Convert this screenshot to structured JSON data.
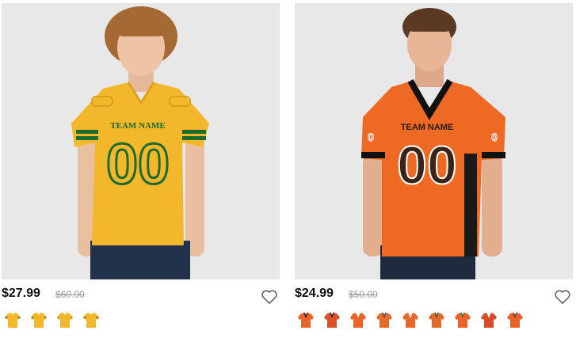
{
  "products": [
    {
      "name": "",
      "price": "$27.99",
      "old_price": "$60.00",
      "jersey": {
        "body": "#F2B72A",
        "trim": "#1E6B2E",
        "sleeve_stripe": "#1E6B2E",
        "team_text": "TEAM NAME",
        "number": "00",
        "text_color": "#1E6B2E"
      },
      "swatch_colors": [
        "#F2B72A",
        "#F2B72A",
        "#F2B72A",
        "#F2B72A"
      ],
      "wishlist_icon": "heart-outline-icon"
    },
    {
      "name": "",
      "price": "$24.99",
      "old_price": "$50.00",
      "jersey": {
        "body": "#EE6A24",
        "trim": "#111111",
        "sleeve_stripe": "#111111",
        "team_text": "TEAM NAME",
        "number": "00",
        "text_color": "#2a1a12"
      },
      "swatch_colors": [
        "#E8622A",
        "#D9502A",
        "#E8622A",
        "#E86A2A",
        "#E8682A",
        "#E26A2A",
        "#E8622A",
        "#D94A2A",
        "#E8622A"
      ],
      "wishlist_icon": "heart-outline-icon"
    }
  ]
}
